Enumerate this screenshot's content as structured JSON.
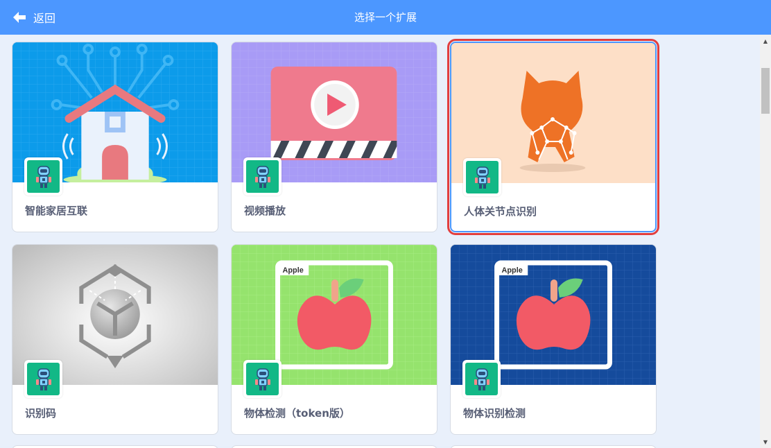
{
  "header": {
    "back_label": "返回",
    "title": "选择一个扩展"
  },
  "cards": [
    {
      "label": "智能家居互联",
      "image": "smart-home-image",
      "selected": false
    },
    {
      "label": "视频播放",
      "image": "video-play-image",
      "selected": false
    },
    {
      "label": "人体关节点识别",
      "image": "body-keypoints-image",
      "selected": true
    },
    {
      "label": "识别码",
      "image": "ar-code-image",
      "selected": false
    },
    {
      "label": "物体检测（token版）",
      "image": "apple-detect-green-image",
      "image_text": "Apple",
      "selected": false
    },
    {
      "label": "物体识别检测",
      "image": "apple-detect-blue-image",
      "image_text": "Apple",
      "selected": false
    }
  ],
  "badge_icon": "robot-icon",
  "colors": {
    "header": "#4c97ff",
    "background": "#e9f0fb",
    "selected_outline": "#e23e3e",
    "badge": "#12b886",
    "label": "#575e75"
  }
}
